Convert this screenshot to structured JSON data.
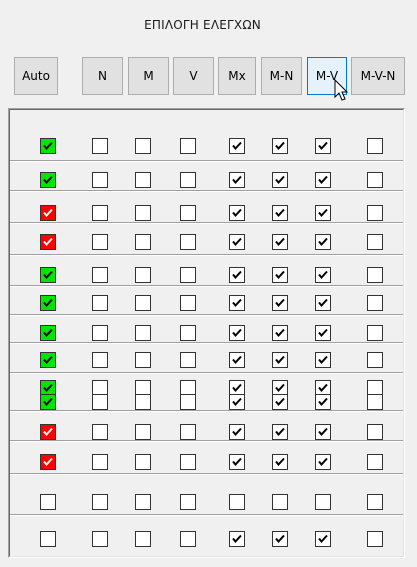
{
  "panel": {
    "title": "ΕΠΙΛΟΓΗ ΕΛΕΓΧΩΝ"
  },
  "columns": [
    {
      "id": "auto",
      "label": "Auto"
    },
    {
      "id": "n",
      "label": "N"
    },
    {
      "id": "m",
      "label": "M"
    },
    {
      "id": "v",
      "label": "V"
    },
    {
      "id": "mx",
      "label": "Mx"
    },
    {
      "id": "m-n",
      "label": "M-N"
    },
    {
      "id": "m-v",
      "label": "M-V"
    },
    {
      "id": "m-v-n",
      "label": "M-V-N"
    }
  ],
  "hovered_column": "m-v",
  "colors": {
    "auto_ok": "#00e600",
    "auto_fail": "#ff0000",
    "check_dark": "#000000",
    "check_light": "#ffffff"
  },
  "rows": [
    {
      "auto": "green",
      "checked": [
        false,
        false,
        false,
        true,
        true,
        true,
        false
      ]
    },
    {
      "auto": "green",
      "checked": [
        false,
        false,
        false,
        true,
        true,
        true,
        false
      ]
    },
    {
      "auto": "red",
      "checked": [
        false,
        false,
        false,
        true,
        true,
        true,
        false
      ]
    },
    {
      "auto": "red",
      "checked": [
        false,
        false,
        false,
        true,
        true,
        true,
        false
      ]
    },
    {
      "auto": "green",
      "checked": [
        false,
        false,
        false,
        true,
        true,
        true,
        false
      ]
    },
    {
      "auto": "green",
      "checked": [
        false,
        false,
        false,
        true,
        true,
        true,
        false
      ]
    },
    {
      "auto": "green",
      "checked": [
        false,
        false,
        false,
        true,
        true,
        true,
        false
      ]
    },
    {
      "auto": "green",
      "checked": [
        false,
        false,
        false,
        true,
        true,
        true,
        false
      ]
    },
    {
      "auto": "green",
      "checked": [
        false,
        false,
        false,
        true,
        true,
        true,
        false
      ]
    },
    {
      "auto": "green",
      "checked": [
        false,
        false,
        false,
        true,
        true,
        true,
        false
      ]
    },
    {
      "auto": "red",
      "checked": [
        false,
        false,
        false,
        true,
        true,
        true,
        false
      ]
    },
    {
      "auto": "red",
      "checked": [
        false,
        false,
        false,
        true,
        true,
        true,
        false
      ]
    },
    {
      "auto": "none",
      "checked": [
        false,
        false,
        false,
        false,
        false,
        false,
        false
      ]
    },
    {
      "auto": "none",
      "checked": [
        false,
        false,
        false,
        true,
        true,
        true,
        false
      ]
    }
  ]
}
